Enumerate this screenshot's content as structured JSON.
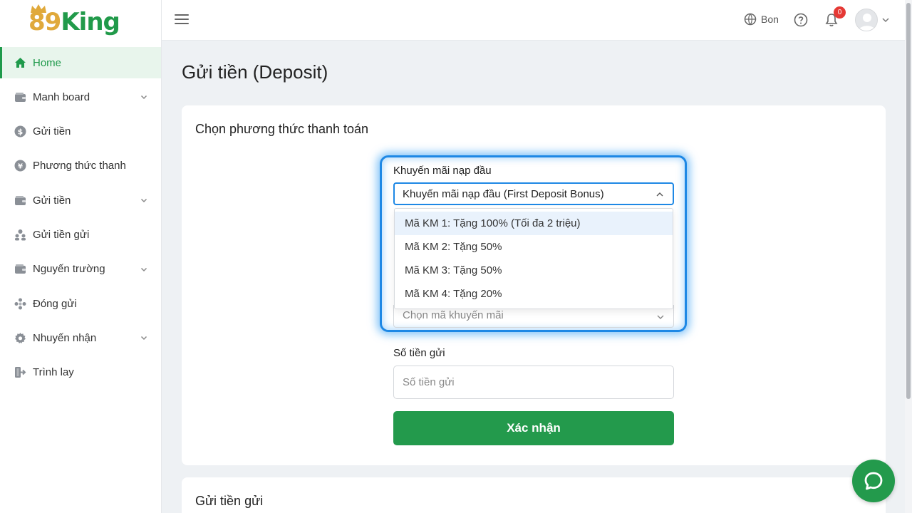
{
  "brand": {
    "logo_number": "89",
    "logo_word": "King"
  },
  "topbar": {
    "language_label": "Bon",
    "notification_count": "0"
  },
  "sidebar": {
    "items": [
      {
        "label": "Home",
        "icon": "home-icon",
        "active": true,
        "expandable": false
      },
      {
        "label": "Manh board",
        "icon": "wallet-icon",
        "active": false,
        "expandable": true
      },
      {
        "label": "Gửi tiền",
        "icon": "dollar-icon",
        "active": false,
        "expandable": false
      },
      {
        "label": "Phương thức thanh",
        "icon": "yen-icon",
        "active": false,
        "expandable": false
      },
      {
        "label": "Gửi tiền",
        "icon": "wallet-icon",
        "active": false,
        "expandable": true
      },
      {
        "label": "Gửi tiền gửi",
        "icon": "users-icon",
        "active": false,
        "expandable": false
      },
      {
        "label": "Nguyến trường",
        "icon": "wallet-icon",
        "active": false,
        "expandable": true
      },
      {
        "label": "Đóng gửi",
        "icon": "cluster-icon",
        "active": false,
        "expandable": false
      },
      {
        "label": "Nhuyến nhận",
        "icon": "gear-icon",
        "active": false,
        "expandable": true
      },
      {
        "label": "Trình lay",
        "icon": "logout-icon",
        "active": false,
        "expandable": false
      }
    ]
  },
  "main": {
    "page_title": "Gửi tiền (Deposit)",
    "payment_card": {
      "title": "Chọn phương thức thanh toán",
      "bonus_label": "Khuyến mãi nạp đầu",
      "bonus_selected": "Khuyến mãi nạp đầu (First Deposit Bonus)",
      "bonus_options": [
        "Mã KM 1: Tặng 100% (Tối đa 2 triệu)",
        "Mã KM 2: Tặng 50%",
        "Mã KM 3: Tặng 50%",
        "Mã KM 4: Tặng 20%"
      ],
      "promo_code_placeholder": "Chọn mã khuyến mãi",
      "amount_label": "Số tiền gửi",
      "amount_placeholder": "Số tiền gửi",
      "submit_label": "Xác nhận"
    },
    "second_card": {
      "title": "Gửi tiền gửi"
    }
  },
  "colors": {
    "brand_green": "#239a4c",
    "logo_gold": "#e0a93b",
    "focus_blue": "#1e88e5",
    "badge_red": "#e53935"
  }
}
